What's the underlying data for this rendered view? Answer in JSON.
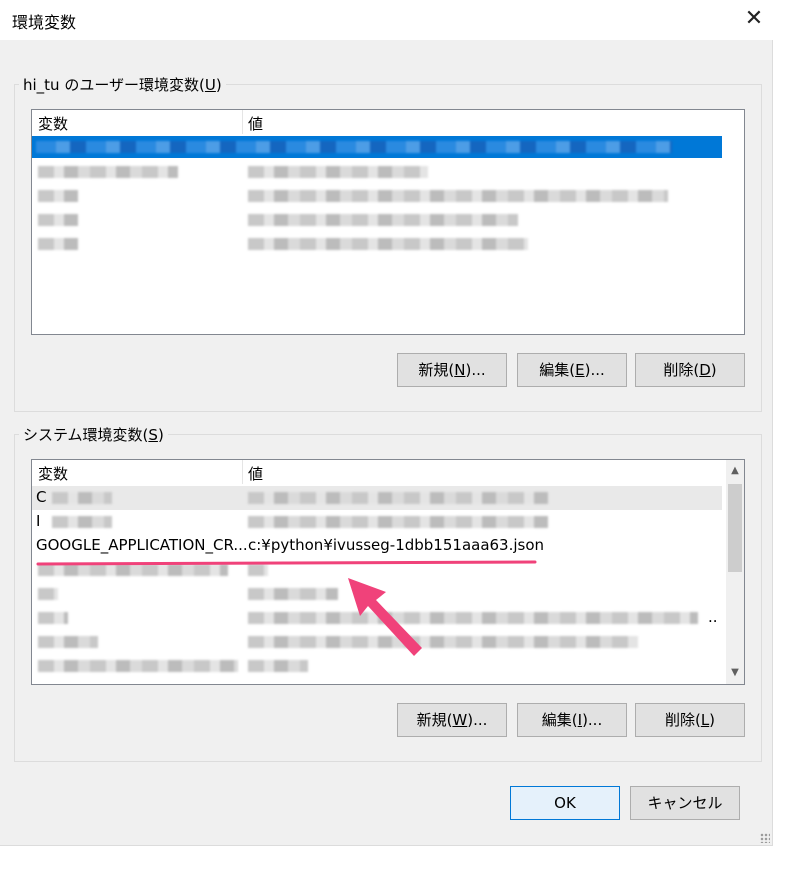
{
  "window": {
    "title": "環境変数",
    "close_glyph": "✕"
  },
  "user_vars": {
    "group_label_prefix": "hi_tu のユーザー環境変数(",
    "group_label_key": "U",
    "group_label_suffix": ")",
    "col_name": "変数",
    "col_value": "値",
    "buttons": {
      "new": {
        "prefix": "新規(",
        "key": "N",
        "suffix": ")..."
      },
      "edit": {
        "prefix": "編集(",
        "key": "E",
        "suffix": ")..."
      },
      "delete": {
        "prefix": "削除(",
        "key": "D",
        "suffix": ")"
      }
    }
  },
  "system_vars": {
    "group_label_prefix": "システム環境変数(",
    "group_label_key": "S",
    "group_label_suffix": ")",
    "col_name": "変数",
    "col_value": "値",
    "highlighted_row": {
      "name": "GOOGLE_APPLICATION_CR...",
      "value": "c:¥python¥ivusseg-1dbb151aaa63.json"
    },
    "row_fragments": {
      "row1_start": "C",
      "row2_start": "I",
      "row6_ellipsis": ".."
    },
    "buttons": {
      "new": {
        "prefix": "新規(",
        "key": "W",
        "suffix": ")..."
      },
      "edit": {
        "prefix": "編集(",
        "key": "I",
        "suffix": ")..."
      },
      "delete": {
        "prefix": "削除(",
        "key": "L",
        "suffix": ")"
      }
    },
    "scroll": {
      "up": "▲",
      "down": "▼"
    }
  },
  "footer": {
    "ok": "OK",
    "cancel": "キャンセル"
  },
  "colors": {
    "selection": "#0078d7",
    "annotation": "#f0427a",
    "dialog_bg": "#f0f0f0"
  }
}
